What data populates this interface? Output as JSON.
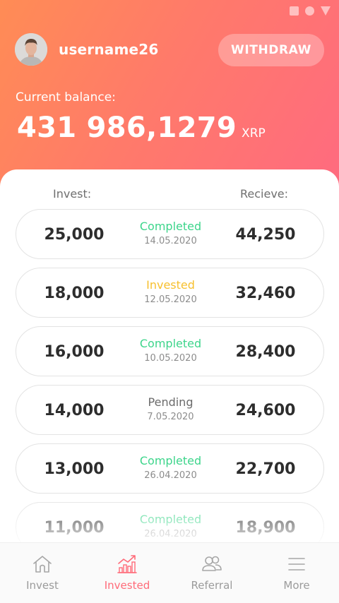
{
  "header": {
    "username": "username26",
    "withdraw_label": "WITHDRAW",
    "balance_label": "Current balance:",
    "balance_value": "431 986,1279",
    "balance_unit": "XRP",
    "gradient_start": "#ff8c55",
    "gradient_end": "#ff6a80"
  },
  "table": {
    "invest_header": "Invest:",
    "receive_header": "Recieve:",
    "rows": [
      {
        "invest": "25,000",
        "status": "Completed",
        "date": "14.05.2020",
        "receive": "44,250",
        "status_type": "completed"
      },
      {
        "invest": "18,000",
        "status": "Invested",
        "date": "12.05.2020",
        "receive": "32,460",
        "status_type": "invested"
      },
      {
        "invest": "16,000",
        "status": "Completed",
        "date": "10.05.2020",
        "receive": "28,400",
        "status_type": "completed"
      },
      {
        "invest": "14,000",
        "status": "Pending",
        "date": "7.05.2020",
        "receive": "24,600",
        "status_type": "pending"
      },
      {
        "invest": "13,000",
        "status": "Completed",
        "date": "26.04.2020",
        "receive": "22,700",
        "status_type": "completed"
      },
      {
        "invest": "11,000",
        "status": "Completed",
        "date": "26.04.2020",
        "receive": "18,900",
        "status_type": "completed"
      }
    ]
  },
  "status_colors": {
    "completed": "#3dd58b",
    "invested": "#f7c02e",
    "pending": "#6b6b6b"
  },
  "nav": {
    "items": [
      {
        "label": "Invest",
        "icon": "home-icon"
      },
      {
        "label": "Invested",
        "icon": "chart-icon"
      },
      {
        "label": "Referral",
        "icon": "users-icon"
      },
      {
        "label": "More",
        "icon": "menu-icon"
      }
    ],
    "active_index": 1,
    "active_color": "#ff6b79"
  }
}
